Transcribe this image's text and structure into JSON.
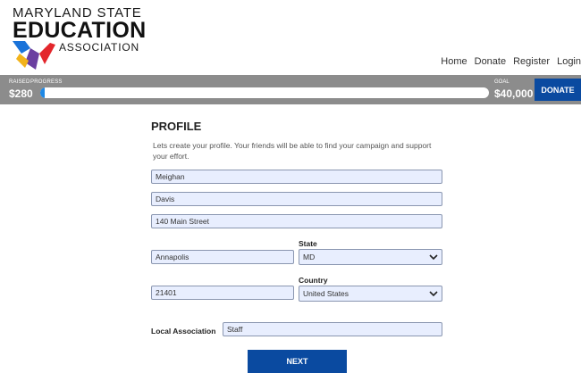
{
  "logo": {
    "line1": "MARYLAND STATE",
    "line2": "EDUCATION",
    "line3": "ASSOCIATION",
    "colors": {
      "blue": "#1a73d9",
      "purple": "#6b3fa0",
      "red": "#e3262b",
      "yellow": "#f2b31b"
    }
  },
  "nav": {
    "items": [
      "Home",
      "Donate",
      "Register",
      "Login"
    ]
  },
  "progress": {
    "raised_label": "RAISED",
    "progress_label": "PROGRESS",
    "raised_value": "$280",
    "goal_label": "GOAL",
    "goal_value": "$40,000",
    "percent": 0.7,
    "fill_color": "#1e88e5",
    "donate_label": "DONATE"
  },
  "form": {
    "title": "PROFILE",
    "description": "Lets create your profile. Your friends will be able to find your campaign and support your effort.",
    "first_name": "Meighan",
    "last_name": "Davis",
    "address": "140 Main Street",
    "city": "Annapolis",
    "state_label": "State",
    "state": "MD",
    "zip": "21401",
    "country_label": "Country",
    "country": "United States",
    "local_assoc_label": "Local Association",
    "local_assoc": "Staff",
    "next_label": "NEXT"
  }
}
